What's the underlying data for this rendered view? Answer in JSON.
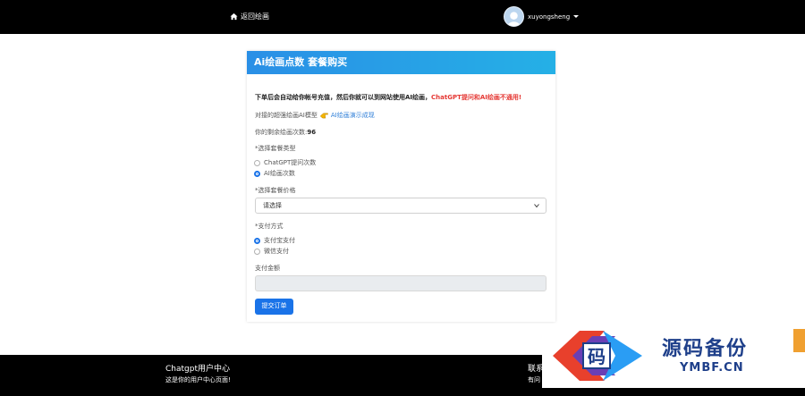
{
  "topbar": {
    "back_label": "返回绘画",
    "username": "xuyongsheng"
  },
  "card": {
    "title": "Ai绘画点数 套餐购买",
    "notice_main": "下单后会自动给你帐号充值，然后你就可以到网站使用AI绘画，",
    "notice_warn": "ChatGPT提问和AI绘画不通用!",
    "model_label": "对接的超强绘画AI模型",
    "model_link": "AI绘画演示成现",
    "remain_label": "你的剩余绘画次数:",
    "remain_value": "96",
    "package_type_label": "*选择套餐类型",
    "package_types": [
      {
        "label": "ChatGPT提问次数",
        "selected": false
      },
      {
        "label": "AI绘画次数",
        "selected": true
      }
    ],
    "price_label": "*选择套餐价格",
    "price_select_value": "请选择",
    "pay_method_label": "*支付方式",
    "pay_methods": [
      {
        "label": "支付宝支付",
        "selected": true
      },
      {
        "label": "微信支付",
        "selected": false
      }
    ],
    "amount_label": "支付金额",
    "amount_value": "",
    "submit_label": "提交订单"
  },
  "footer": {
    "title": "Chatgpt用户中心",
    "subtitle": "这是你的用户中心页面!",
    "right_title": "联系",
    "right_sub": "有问"
  },
  "watermark": {
    "logo_char": "码",
    "cn": "源码备份",
    "en": "YMBF.CN"
  },
  "colors": {
    "header_gradient_start": "#2a8fe6",
    "header_gradient_end": "#25b0e6",
    "primary": "#1a73e8",
    "warn": "#e53935",
    "bar": "#000000"
  }
}
